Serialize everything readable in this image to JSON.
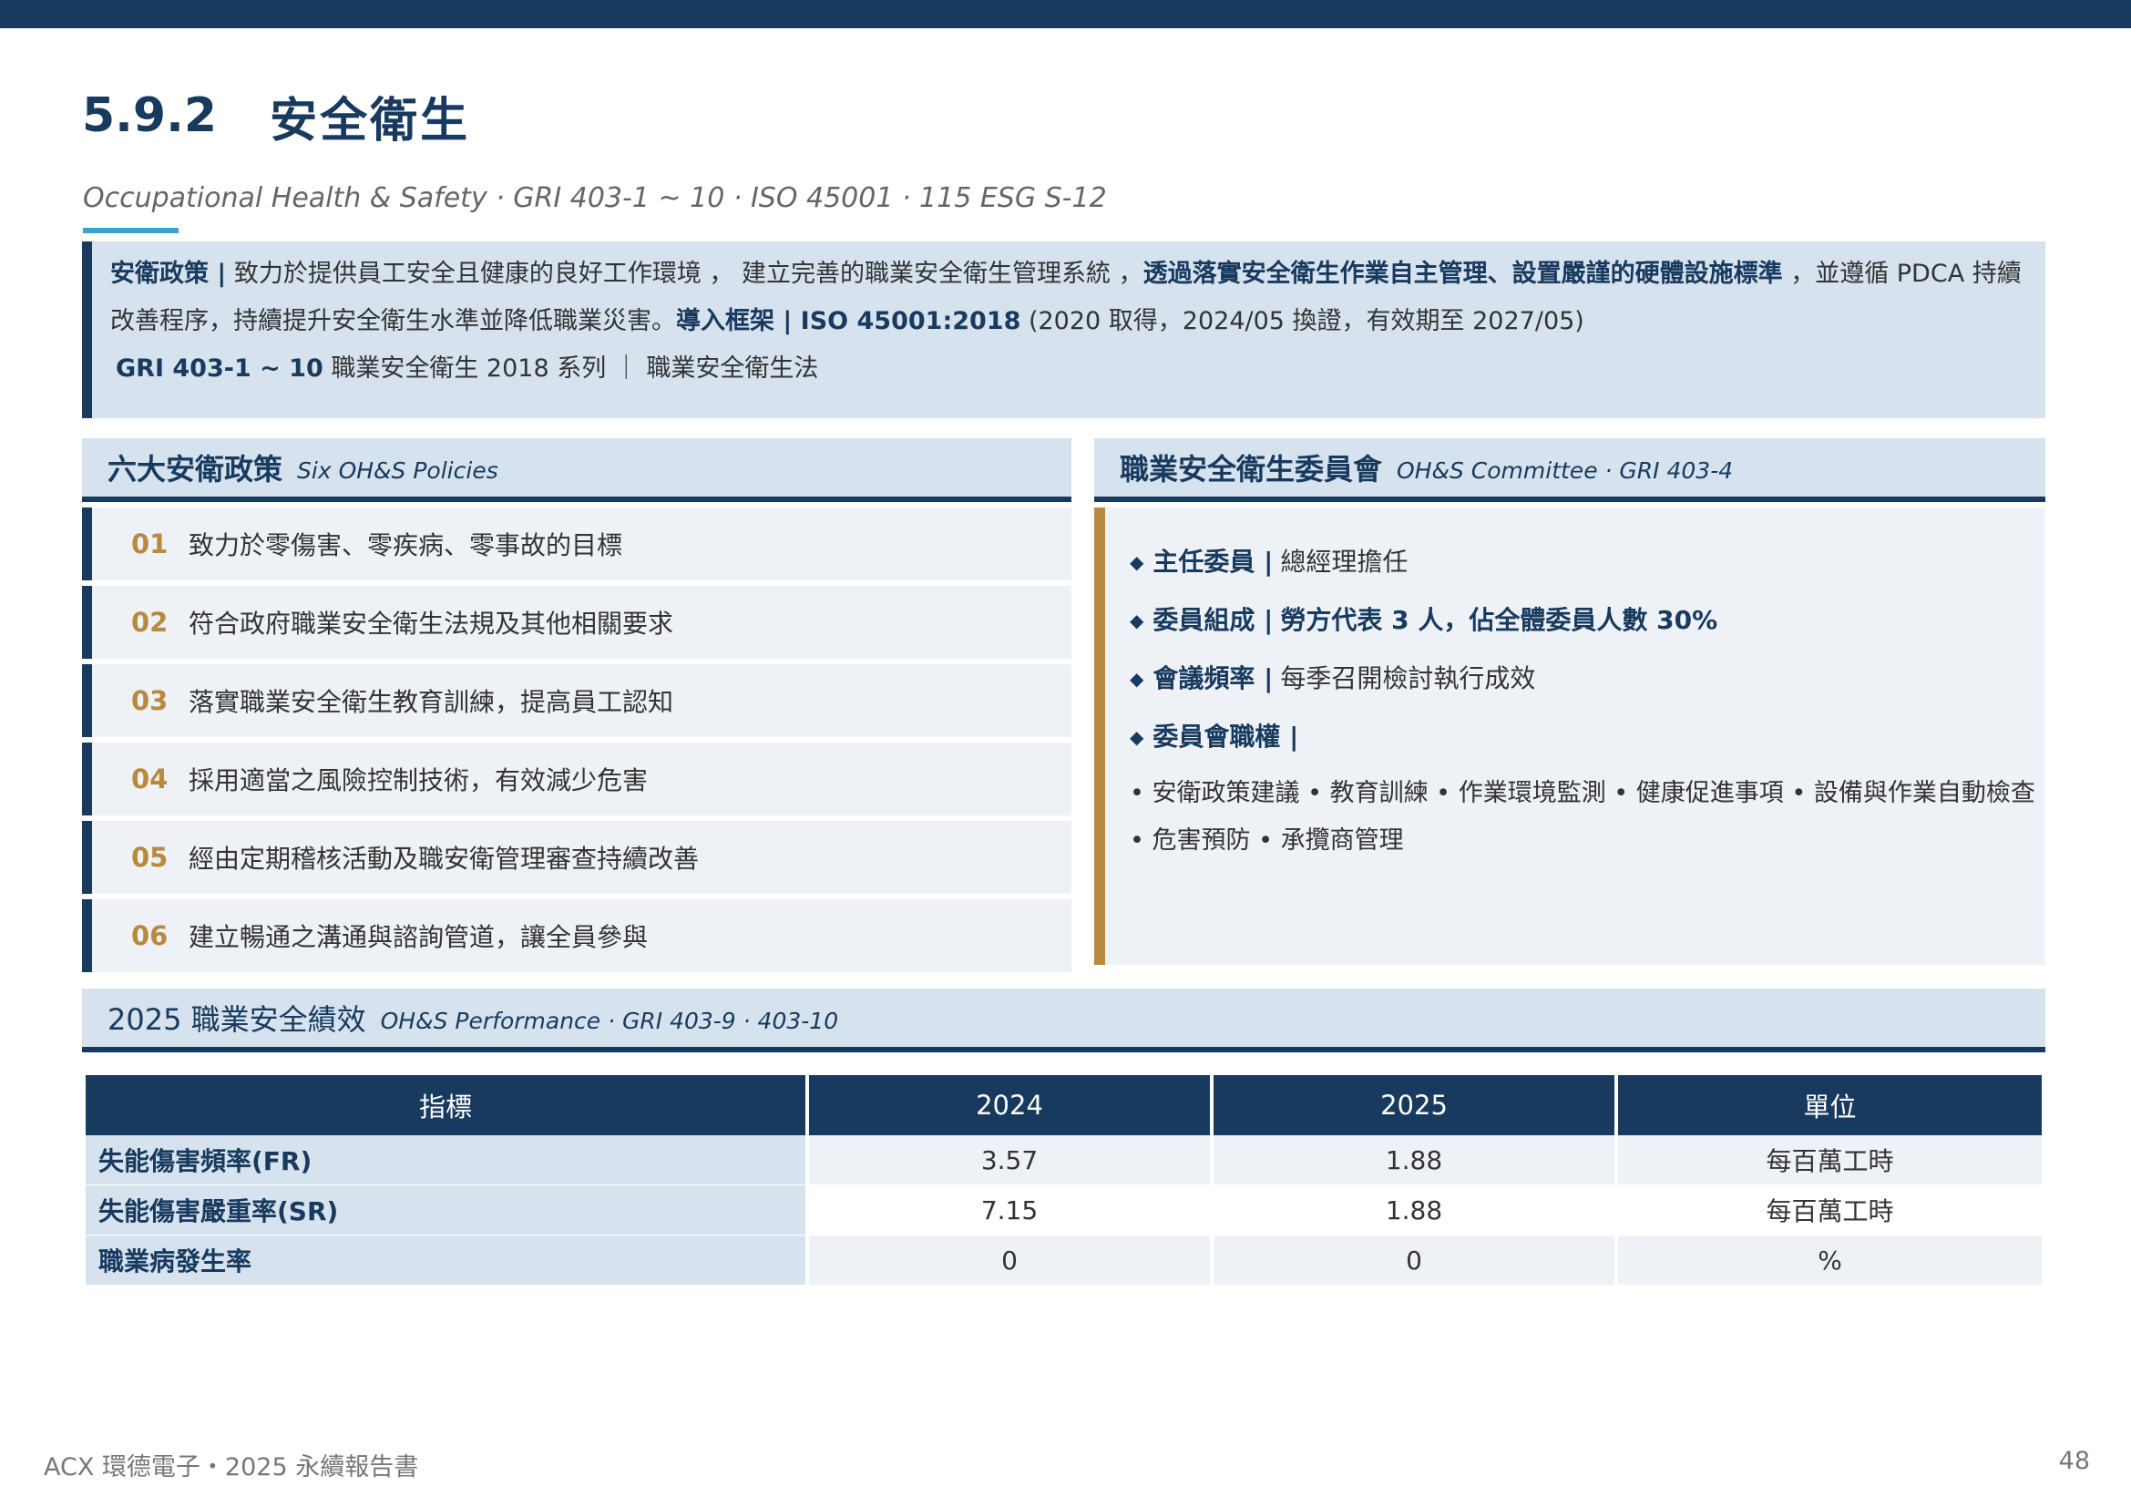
{
  "colors": {
    "navy": "#173a5e",
    "light_blue": "#d6e2ee",
    "pale": "#eef2f7",
    "gold": "#b8893f",
    "accent": "#3fa0d8"
  },
  "header": {
    "number": "5.9.2",
    "title": "安全衛生",
    "subtitle": "Occupational Health & Safety · GRI 403-1 ~ 10 · ISO 45001 · 115 ESG S-12"
  },
  "policy": {
    "label": "安衛政策 |",
    "text1": " 致力於提供員工安全且健康的良好工作環境 ， 建立完善的職業安全衛生管理系統 ，",
    "bold1": "透過落實安全衛生作業自主管理、設置嚴謹的硬體設施標準",
    "text2": " ，並遵循 PDCA 持續改善程序，持續提升安全衛生水準並降低職業災害。",
    "framework_label": "導入框架 | ISO 45001:2018",
    "framework_text": " (2020 取得，2024/05 換證，有效期至 2027/05)",
    "gri_label": "GRI 403-1 ~ 10",
    "gri_text": " 職業安全衛生 2018 系列 ｜ 職業安全衛生法"
  },
  "six_policies": {
    "title_zh": "六大安衛政策",
    "title_en": "Six OH&S Policies",
    "items": [
      {
        "no": "01",
        "text": "致力於零傷害、零疾病、零事故的目標"
      },
      {
        "no": "02",
        "text": "符合政府職業安全衛生法規及其他相關要求"
      },
      {
        "no": "03",
        "text": "落實職業安全衛生教育訓練，提高員工認知"
      },
      {
        "no": "04",
        "text": "採用適當之風險控制技術，有效減少危害"
      },
      {
        "no": "05",
        "text": "經由定期稽核活動及職安衛管理審查持續改善"
      },
      {
        "no": "06",
        "text": "建立暢通之溝通與諮詢管道，讓全員參與"
      }
    ]
  },
  "committee": {
    "title_zh": "職業安全衛生委員會",
    "title_en": "OH&S Committee · GRI 403-4",
    "bullet": "◆",
    "chair_label": "主任委員 |",
    "chair_value": "總經理擔任",
    "composition_label": "委員組成 |",
    "composition_value": "勞方代表 3 人，佔全體委員人數 30%",
    "frequency_label": "會議頻率 |",
    "frequency_value": "每季召開檢討執行成效",
    "duties_label": "委員會職權 |",
    "duties_text": "• 安衛政策建議 • 教育訓練 • 作業環境監測 • 健康促進事項 • 設備與作業自動檢查 • 危害預防 • 承攬商管理"
  },
  "performance": {
    "title_zh": "2025 職業安全績效",
    "title_en": "OH&S Performance · GRI 403-9 · 403-10",
    "headers": [
      "指標",
      "2024",
      "2025",
      "單位"
    ],
    "rows": [
      [
        "失能傷害頻率(FR)",
        "3.57",
        "1.88",
        "每百萬工時"
      ],
      [
        "失能傷害嚴重率(SR)",
        "7.15",
        "1.88",
        "每百萬工時"
      ],
      [
        "職業病發生率",
        "0",
        "0",
        "%"
      ]
    ]
  },
  "footer": {
    "text": "ACX 環德電子・2025 永續報告書",
    "page": "48"
  }
}
